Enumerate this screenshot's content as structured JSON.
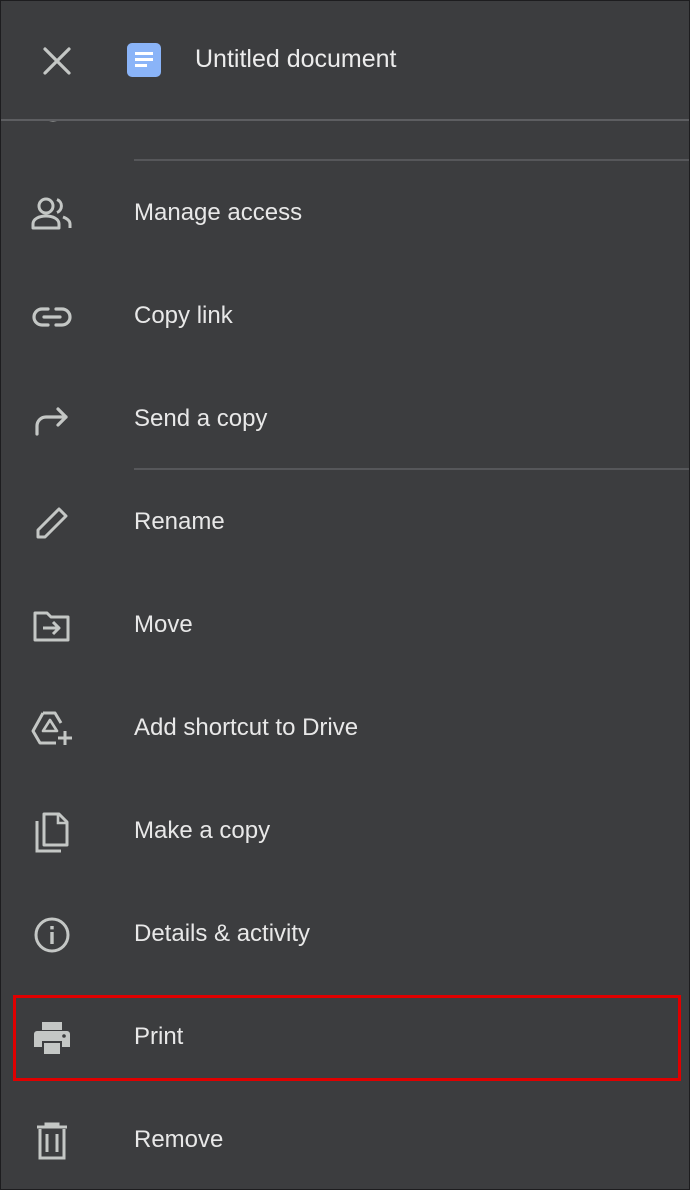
{
  "header": {
    "title": "Untitled document",
    "close_icon": "close-icon",
    "doc_icon": "google-docs-icon",
    "doc_icon_color": "#8ab4f8"
  },
  "menu": {
    "items": [
      {
        "label": "Manage access",
        "icon": "people-icon"
      },
      {
        "label": "Copy link",
        "icon": "link-icon"
      },
      {
        "label": "Send a copy",
        "icon": "forward-arrow-icon"
      },
      {
        "label": "Rename",
        "icon": "pencil-icon"
      },
      {
        "label": "Move",
        "icon": "move-folder-icon"
      },
      {
        "label": "Add shortcut to Drive",
        "icon": "drive-shortcut-icon"
      },
      {
        "label": "Make a copy",
        "icon": "copy-file-icon"
      },
      {
        "label": "Details & activity",
        "icon": "info-icon"
      },
      {
        "label": "Print",
        "icon": "printer-icon",
        "highlighted": true
      },
      {
        "label": "Remove",
        "icon": "trash-icon"
      }
    ]
  },
  "colors": {
    "background": "#3c3d3f",
    "text": "#e8e8e8",
    "icon": "#c4c7c5",
    "divider": "#56575a",
    "highlight_border": "#e00000"
  }
}
